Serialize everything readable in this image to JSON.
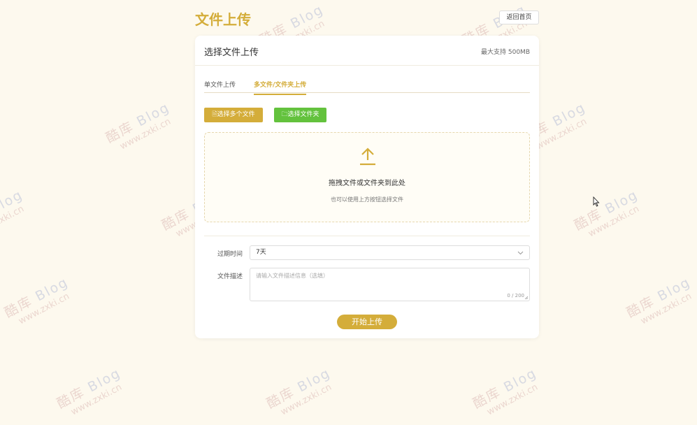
{
  "page": {
    "title": "文件上传",
    "back_button": "返回首页"
  },
  "card": {
    "title": "选择文件上传",
    "limit": "最大支持 500MB"
  },
  "tabs": [
    {
      "label": "单文件上传",
      "active": false
    },
    {
      "label": "多文件/文件夹上传",
      "active": true
    }
  ],
  "buttons": {
    "select_files": "选择多个文件",
    "select_folder": "选择文件夹",
    "start_upload": "开始上传"
  },
  "dropzone": {
    "icon": "upload-arrow-icon",
    "main_text": "拖拽文件或文件夹到此处",
    "sub_text": "也可以使用上方按钮选择文件"
  },
  "form": {
    "expiry_label": "过期时间",
    "expiry_value": "7天",
    "description_label": "文件描述",
    "description_placeholder": "请输入文件描述信息（选填）",
    "description_count": "0 / 200"
  },
  "watermark": {
    "brand_left": "酷库",
    "brand_right": "Blog",
    "url": "www.zxki.cn"
  },
  "colors": {
    "accent": "#d4ad3a",
    "green": "#63c23d",
    "background": "#fdf9ee"
  }
}
